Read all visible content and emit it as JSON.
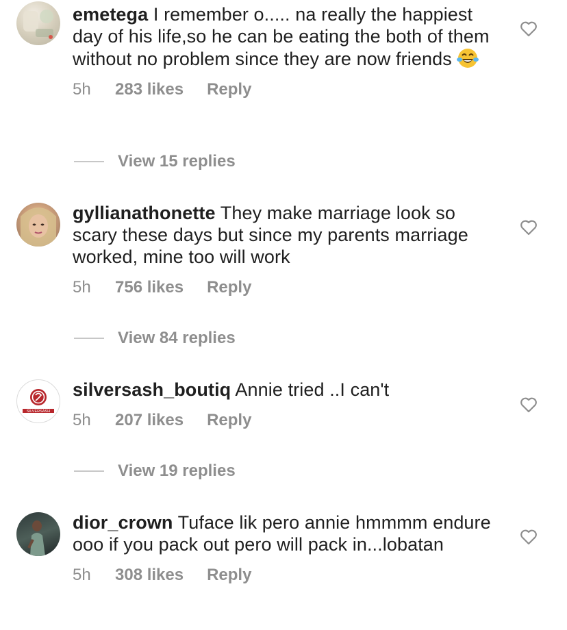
{
  "comments": [
    {
      "username": "emetega",
      "text": "I remember o..... na really the happiest day of his life,so he can be eating the both of them without no problem since they are now friends",
      "emoji": "😂",
      "time": "5h",
      "likes": "283 likes",
      "reply_label": "Reply",
      "view_replies": "View 15 replies"
    },
    {
      "username": "gyllianathonette",
      "text": "They make marriage look so scary these days but since my parents marriage worked, mine too will work",
      "time": "5h",
      "likes": "756 likes",
      "reply_label": "Reply",
      "view_replies": "View 84 replies"
    },
    {
      "username": "silversash_boutiq",
      "text": "Annie tried ..I can't",
      "time": "5h",
      "likes": "207 likes",
      "reply_label": "Reply",
      "view_replies": "View 19 replies",
      "avatar_text": "SILVERSASH"
    },
    {
      "username": "dior_crown",
      "text": "Tuface lik pero annie hmmmm endure ooo if you pack out pero will pack in...lobatan",
      "time": "5h",
      "likes": "308 likes",
      "reply_label": "Reply"
    }
  ],
  "icons": {
    "like": "heart-outline-icon",
    "emoji": "face-with-tears-of-joy"
  },
  "colors": {
    "text": "#1f1f1f",
    "meta": "#8e8e8e",
    "divider": "#c7c7c7"
  }
}
